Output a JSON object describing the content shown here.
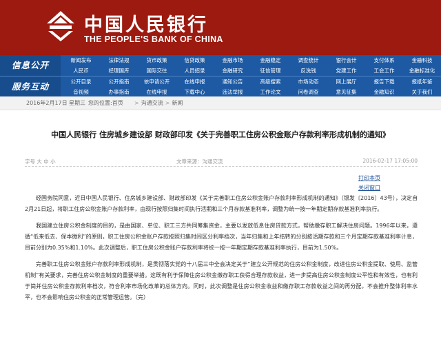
{
  "header": {
    "brand_cn": "中国人民银行",
    "brand_en": "THE PEOPLE'S BANK OF CHINA",
    "logo_icon": "pboc-logo-icon",
    "background": "#9c1a10"
  },
  "nav": {
    "background": "#1d5aa3",
    "row1": {
      "label": "信息公开",
      "items": [
        "新闻发布",
        "法律法规",
        "货币政策",
        "信贷政策",
        "金融市场",
        "金融稳定",
        "调查统计",
        "银行会计",
        "支付体系",
        "金融科技",
        "人民币",
        "经理国库",
        "国际交往",
        "人员招录",
        "金融研究",
        "征信管理",
        "反洗钱",
        "党建工作",
        "工会工作",
        "金融标准化"
      ]
    },
    "row2": {
      "label": "服务互动",
      "items": [
        "公开目录",
        "公开指南",
        "依申请公开",
        "在线申报",
        "通知公告",
        "高级搜索",
        "市场动态",
        "网上展厅",
        "报告下载",
        "报纸年鉴",
        "音视频",
        "办事指南",
        "在线申报",
        "下载中心",
        "违法举报",
        "工作论文",
        "问卷调查",
        "意见征集",
        "金融知识",
        "关于我们"
      ]
    }
  },
  "breadcrumb": {
    "date": "2016年2月17日",
    "weekday": "星期三",
    "location_label": "您的位置:首页",
    "level1": "沟通交流",
    "level2": "新闻"
  },
  "article": {
    "title": "中国人民银行 住房城乡建设部 财政部印发《关于完善职工住房公积金账户存款利率形成机制的通知》",
    "font_size_label": "字号 大 中 小",
    "source": "文章来源：沟通交流",
    "publish_time": "2016-02-17 17:05:00",
    "print_label": "打印本页",
    "close_label": "关闭窗口",
    "paragraphs": [
      "经国务院同意，近日中国人民银行、住房城乡建设部、财政部印发《关于完善职工住房公积金账户存款利率形成机制的通知》（银发〔2016〕43号），决定自2月21日起，将职工住房公积金账户存款利率，由现行按照归集时间执行活期和三个月存款基准利率，调整为统一按一年期定期存款基准利率执行。",
      "我国建立住房公积金制度的目的，是由国家、单位、职工三方共同筹集资金，主要以发放低息住房贷款方式，帮助缴存职工解决住房问题。1996年以来，遵循“低来低去、保本微利”的原则，职工住房公积金账户存款按照归集时间区分利率档次，当年归集和上年结转的分别按活期存款和三个月定期存款基准利率计息，目前分别为0.35%和1.10%。此次调整后，职工住房公积金账户存款利率将统一按一年期定期存款基准利率执行，目前为1.50%。",
      "完善职工住房公积金账户存款利率形成机制，是贯彻落实党的十八届三中全会决定关于“建立公开规范的住房公积金制度，改进住房公积金提取、使用、监管机制”有关要求，完善住房公积金制度的重要举措。这既有利于保障住房公积金缴存职工获得合理存款收益，进一步提高住房公积金制度公平性和有效性，也有利于简并住房公积金存款利率档次，符合利率市场化改革的总体方向。同时，此次调整是住房公积金收益和缴存职工存款收益之间的再分配，不会推升整体利率水平，也不会影响住房公积金的正常管理运营。（完）"
    ]
  }
}
